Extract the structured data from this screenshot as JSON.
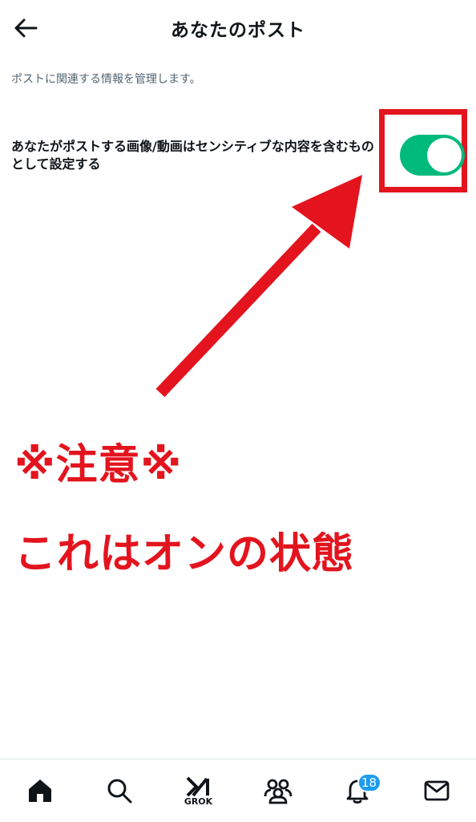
{
  "header": {
    "title": "あなたのポスト",
    "back_icon": "arrow-left-icon"
  },
  "description": "ポストに関連する情報を管理します。",
  "setting": {
    "label": "あなたがポストする画像/動画はセンシティブな内容を含むものとして設定する",
    "toggle_on": true,
    "toggle_color": "#00ba7c"
  },
  "annotation": {
    "notice": "※注意※",
    "state_text": "これはオンの状態",
    "color": "#e3141e"
  },
  "bottom_nav": {
    "items": [
      {
        "icon": "home-icon"
      },
      {
        "icon": "search-icon"
      },
      {
        "icon": "grok-icon",
        "label": "GROK"
      },
      {
        "icon": "communities-icon"
      },
      {
        "icon": "bell-icon",
        "badge": "18"
      },
      {
        "icon": "mail-icon"
      }
    ],
    "badge_color": "#1d9bf0"
  }
}
